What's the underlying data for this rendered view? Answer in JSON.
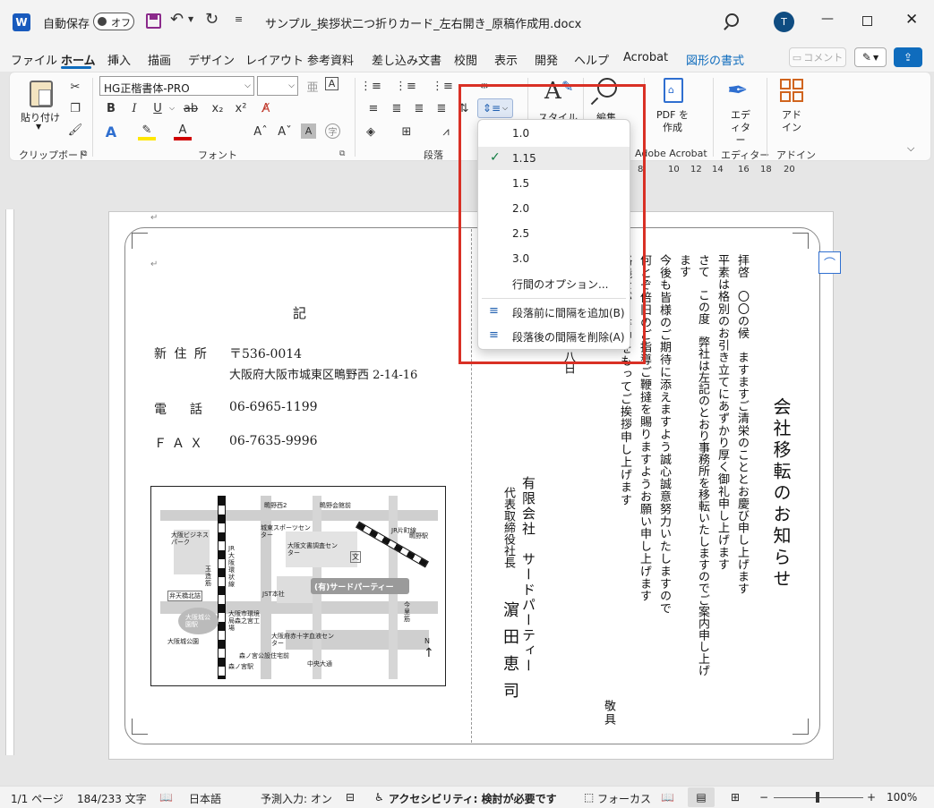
{
  "titlebar": {
    "autosave_label": "自動保存",
    "autosave_state": "オフ",
    "doc_title": "サンプル_挨拶状二つ折りカード_左右開き_原稿作成用.docx",
    "user_initial": "T"
  },
  "tabs": [
    "ファイル",
    "ホーム",
    "挿入",
    "描画",
    "デザイン",
    "レイアウト",
    "参考資料",
    "差し込み文書",
    "校閲",
    "表示",
    "開発",
    "ヘルプ",
    "Acrobat",
    "図形の書式"
  ],
  "comment_button": "コメント",
  "ribbon": {
    "paste_label": "貼り付け",
    "clipboard_group": "クリップボード",
    "font_name": "HG正楷書体-PRO",
    "font_size": "",
    "font_group": "フォント",
    "paragraph_group": "段落",
    "style_label": "スタイル",
    "edit_label": "編集",
    "pdf_label": "PDF を作成",
    "acrobat_group": "Adobe Acrobat",
    "editor_label": "エディター",
    "editor_group": "エディター",
    "addin_label": "アドイン",
    "addin_group": "アドイン"
  },
  "ruler_numbers": [
    "8",
    "10",
    "12",
    "14",
    "16",
    "18",
    "20"
  ],
  "line_spacing_menu": {
    "options": [
      "1.0",
      "1.15",
      "1.5",
      "2.0",
      "2.5",
      "3.0"
    ],
    "selected": "1.15",
    "more": "行間のオプション...",
    "add_before": "段落前に間隔を追加(B)",
    "remove_after": "段落後の間隔を削除(A)"
  },
  "document": {
    "ki": "記",
    "address_label": "新 住 所",
    "postal": "〒536-0014",
    "address": "大阪府大阪市城東区鴫野西 2-14-16",
    "tel_label": "電　話",
    "tel": "06-6965-1199",
    "fax_label": "ＦＡＸ",
    "fax": "06-7635-9996",
    "title": "会社移転のお知らせ",
    "letter_lines": [
      "拝啓　〇〇の候　ますますご清栄のこととお慶び申し上げます",
      "平素は格別のお引き立てにあずかり厚く御礼申し上げます",
      "さて　この度　弊社は左記のとおり事務所を移転いたしますのでご案内申し上げ",
      "ます",
      "今後も皆様のご期待に添えますよう誠心誠意努力いたしますので",
      "何とぞ倍旧のご指導ご鞭撻を賜りますようお願い申し上げます",
      "略儀ながら書中をもってご挨拶申し上げます"
    ],
    "keigu": "敬具",
    "date_fragment": "八日",
    "company": "有限会社　サードパーティー",
    "rep_title": "代表取締役社長",
    "rep_name": "濵田恵司",
    "map": {
      "station_top": "鴫野西2",
      "junction": "鴫野会館前",
      "jr_line": "JR片町線",
      "sports": "城東スポーツセンター",
      "library": "大阪文書調査センター",
      "business_park": "大阪ビジネスパーク",
      "jr_loop": "JR大阪環状線",
      "tamatsukuri": "玉造筋",
      "bentencho": "弁天橋北詰",
      "jst": "JST本社",
      "third_party": "(有)サードパーティー",
      "factory": "大阪市環境局森之宮工場",
      "osakajo": "大阪城公園駅",
      "osaka_park": "大阪城公園",
      "blood": "大阪府赤十字血液センター",
      "morinomiya": "森ノ宮駅",
      "center_road": "中央大通",
      "shiginosta": "鴫野駅",
      "imazato": "今里筋",
      "bunka": "文",
      "morinomiya_bus": "森ノ宮公設住宅前",
      "north": "N"
    }
  },
  "status": {
    "page": "1/1 ページ",
    "words": "184/233 文字",
    "lang": "日本語",
    "predict": "予測入力: オン",
    "access": "アクセシビリティ: 検討が必要です",
    "focus": "フォーカス",
    "zoom": "100%"
  },
  "colors": {
    "accent": "#0f6cbd",
    "highlight_box": "#d93025",
    "word_blue": "#185abd"
  }
}
